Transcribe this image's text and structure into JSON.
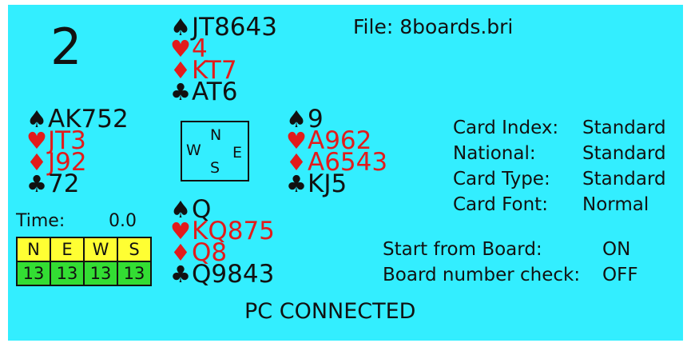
{
  "board": {
    "number": "2"
  },
  "file": {
    "label": "File:",
    "name": "8boards.bri"
  },
  "hands": {
    "north": {
      "spades": "JT8643",
      "hearts": "4",
      "diamonds": "KT7",
      "clubs": "AT6"
    },
    "west": {
      "spades": "AK752",
      "hearts": "JT3",
      "diamonds": "J92",
      "clubs": "72"
    },
    "east": {
      "spades": "9",
      "hearts": "A962",
      "diamonds": "A6543",
      "clubs": "KJ5"
    },
    "south": {
      "spades": "Q",
      "hearts": "KQ875",
      "diamonds": "Q8",
      "clubs": "Q9843"
    }
  },
  "suit_symbols": {
    "spades": "♠",
    "hearts": "♥",
    "diamonds": "♦",
    "clubs": "♣"
  },
  "compass": {
    "n": "N",
    "w": "W",
    "e": "E",
    "s": "S"
  },
  "timer": {
    "label": "Time:",
    "value": "0.0"
  },
  "card_counts": {
    "directions": [
      "N",
      "E",
      "W",
      "S"
    ],
    "counts": [
      "13",
      "13",
      "13",
      "13"
    ]
  },
  "settings": [
    {
      "key": "Card Index:",
      "value": "Standard"
    },
    {
      "key": "National:",
      "value": "Standard"
    },
    {
      "key": "Card Type:",
      "value": "Standard"
    },
    {
      "key": "Card Font:",
      "value": "Normal"
    }
  ],
  "options": [
    {
      "key": "Start from Board:",
      "value": "ON"
    },
    {
      "key": "Board number check:",
      "value": "OFF"
    }
  ],
  "status": "PC CONNECTED",
  "colors": {
    "background": "#33eeff",
    "red_suit": "#e21b1b",
    "black_suit": "#111111",
    "direction_cell": "#ffff33",
    "count_cell": "#33dd33"
  }
}
